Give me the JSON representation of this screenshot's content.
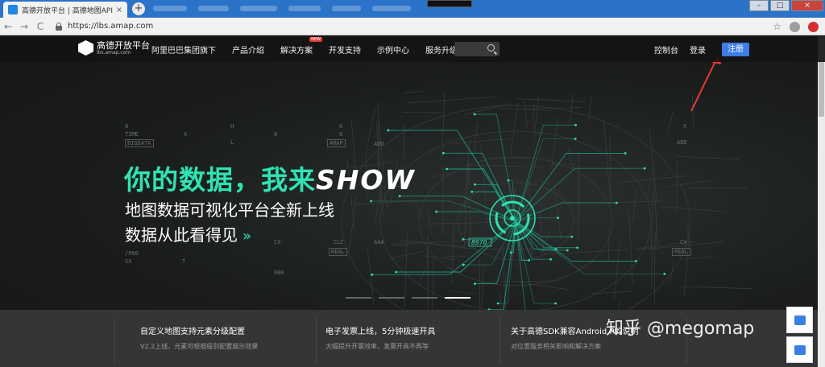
{
  "browser": {
    "tab_title": "高德开放平台 | 高德地图API",
    "tab_close": "×",
    "new_tab": "+",
    "url": "https://lbs.amap.com",
    "back": "←",
    "forward": "→",
    "reload": "C",
    "bookmark": "☆"
  },
  "window": {
    "minimize": "–",
    "maximize": "□",
    "close": "×"
  },
  "header": {
    "logo_title": "高德开放平台",
    "logo_sub": "lbs.amap.com",
    "nav": [
      {
        "label": "阿里巴巴集团旗下"
      },
      {
        "label": "产品介绍"
      },
      {
        "label": "解决方案",
        "badge": "NEW"
      },
      {
        "label": "开发支持"
      },
      {
        "label": "示例中心"
      },
      {
        "label": "服务升级"
      }
    ],
    "console": "控制台",
    "login": "登录",
    "register": "注册"
  },
  "hero": {
    "title_cn": "你的数据，我来",
    "title_en": "SHOW",
    "subtitle_1": "地图数据可视化平台全新上线",
    "subtitle_2": "数据从此看得见",
    "chevrons": "»",
    "number_label": "8970",
    "codes": {
      "time": "TIME",
      "bigdata": "BIGDATA",
      "amap": "AMAP",
      "add1": "ADD",
      "add2": "ADD",
      "cx1": "CX",
      "cx2": "CX",
      "clc": "CLC",
      "real1": "REAL",
      "real2": "REAL",
      "aaa": "AAA",
      "p80": "/P80",
      "sx": "SX",
      "ooo": "000"
    }
  },
  "slider": {
    "count": 4,
    "active": 3
  },
  "news": [
    {
      "title": "自定义地图支持元素分级配置",
      "desc": "V2.2上线，元素可根据级别配置展示效果"
    },
    {
      "title": "电子发票上线，5分钟极速开具",
      "desc": "大幅提升开票效率，发票开具不再等"
    },
    {
      "title": "关于高德SDK兼容Android P的说明",
      "desc": "对位置服务相关影响和解决方案"
    }
  ],
  "watermark": "知乎 @megomap",
  "colors": {
    "accent": "#2fe3b3",
    "register_btn": "#3d7de6",
    "badge_new": "#e53935",
    "annotation_arrow": "#e53935"
  }
}
